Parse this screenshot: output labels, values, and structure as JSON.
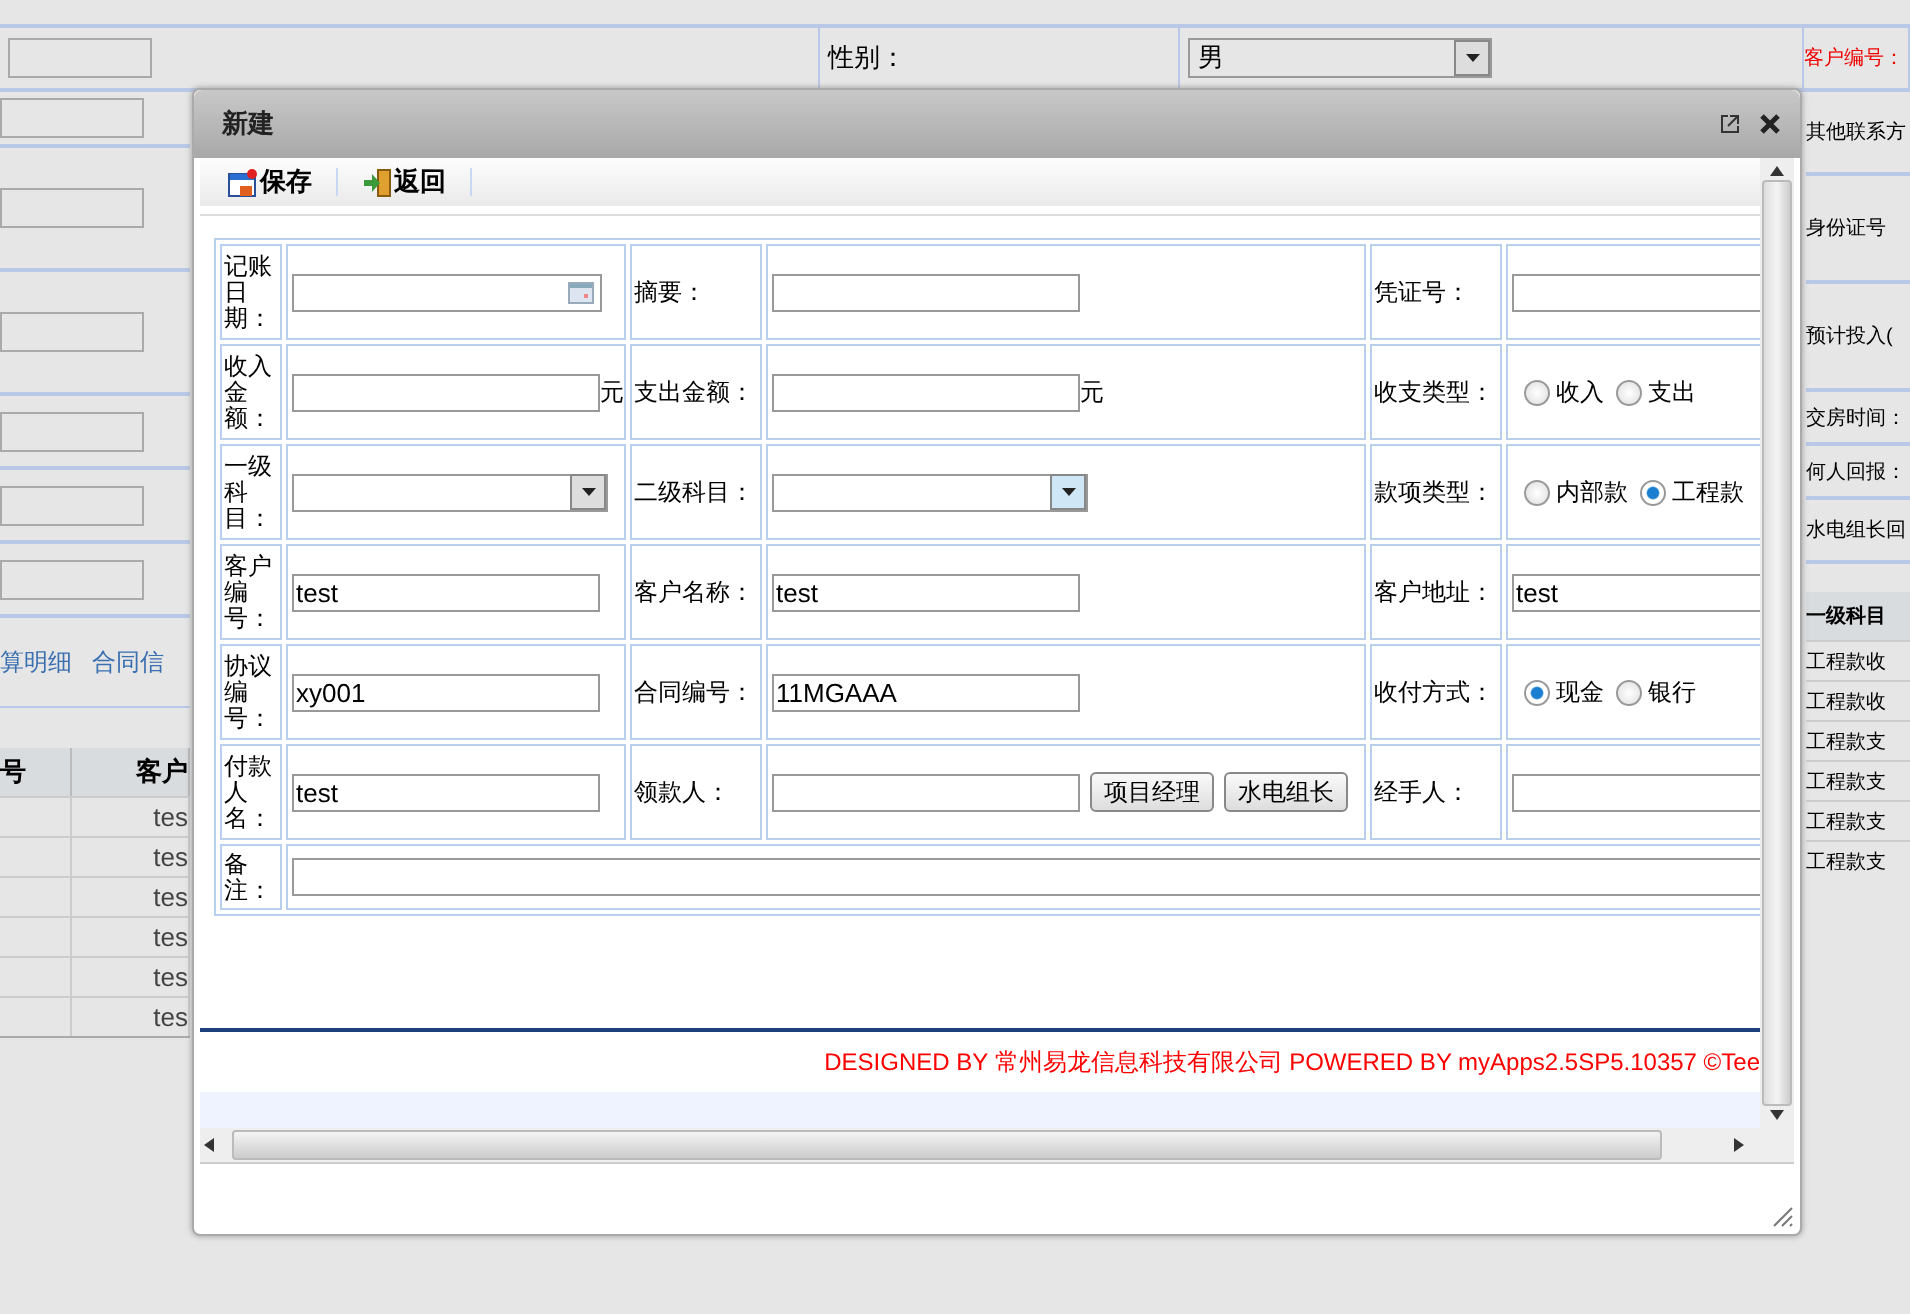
{
  "background": {
    "gender_label": "性别：",
    "gender_select": "男",
    "customer_no_label": "客户编号：",
    "left_tabs": [
      "算明细",
      "合同信"
    ],
    "left_table": {
      "columns": [
        "号",
        "客户"
      ],
      "rows": [
        "tes",
        "tes",
        "tes",
        "tes",
        "tes",
        "tes"
      ]
    },
    "right_labels": [
      "其他联系方",
      "身份证号",
      "预计投入(",
      "交房时间：",
      "何人回报：",
      "水电组长回"
    ],
    "right_table": {
      "column": "一级科目",
      "rows": [
        "工程款收",
        "工程款收",
        "工程款支",
        "工程款支",
        "工程款支",
        "工程款支"
      ]
    }
  },
  "dialog": {
    "title": "新建",
    "toolbar": [
      {
        "kind": "save",
        "label": "保存"
      },
      {
        "kind": "back",
        "label": "返回"
      }
    ],
    "form": [
      [
        {
          "label": "记账日期：",
          "field": {
            "kind": "date"
          }
        },
        {
          "label": "摘要：",
          "field": {
            "kind": "text"
          }
        },
        {
          "label": "凭证号：",
          "field": {
            "kind": "text"
          }
        }
      ],
      [
        {
          "label": "收入金额：",
          "field": {
            "kind": "text",
            "suffix": "元"
          }
        },
        {
          "label": "支出金额：",
          "field": {
            "kind": "text",
            "suffix": "元"
          }
        },
        {
          "label": "收支类型：",
          "field": {
            "kind": "radio",
            "options": [
              {
                "label": "收入",
                "selected": false
              },
              {
                "label": "支出",
                "selected": false
              }
            ]
          }
        }
      ],
      [
        {
          "label": "一级科目：",
          "field": {
            "kind": "select",
            "focused": false
          }
        },
        {
          "label": "二级科目：",
          "field": {
            "kind": "select",
            "focused": true
          }
        },
        {
          "label": "款项类型：",
          "field": {
            "kind": "radio",
            "options": [
              {
                "label": "内部款",
                "selected": false
              },
              {
                "label": "工程款",
                "selected": true
              }
            ]
          }
        }
      ],
      [
        {
          "label": "客户编号：",
          "field": {
            "kind": "text",
            "value": "test"
          }
        },
        {
          "label": "客户名称：",
          "field": {
            "kind": "text",
            "value": "test"
          }
        },
        {
          "label": "客户地址：",
          "field": {
            "kind": "text",
            "value": "test"
          }
        }
      ],
      [
        {
          "label": "协议编号：",
          "field": {
            "kind": "text",
            "value": "xy001"
          }
        },
        {
          "label": "合同编号：",
          "field": {
            "kind": "text",
            "value": "11MGAAA"
          }
        },
        {
          "label": "收付方式：",
          "field": {
            "kind": "radio",
            "options": [
              {
                "label": "现金",
                "selected": true
              },
              {
                "label": "银行",
                "selected": false
              }
            ]
          }
        }
      ],
      [
        {
          "label": "付款人名：",
          "field": {
            "kind": "text",
            "value": "test"
          }
        },
        {
          "label": "领款人：",
          "field": {
            "kind": "text",
            "buttons": [
              "项目经理",
              "水电组长"
            ]
          }
        },
        {
          "label": "经手人：",
          "field": {
            "kind": "text"
          }
        }
      ],
      [
        {
          "label": "备注：",
          "field": {
            "kind": "textarea"
          }
        }
      ]
    ],
    "footer": "DESIGNED BY 常州易龙信息科技有限公司 POWERED BY myApps2.5SP5.10357 ©Tee"
  }
}
